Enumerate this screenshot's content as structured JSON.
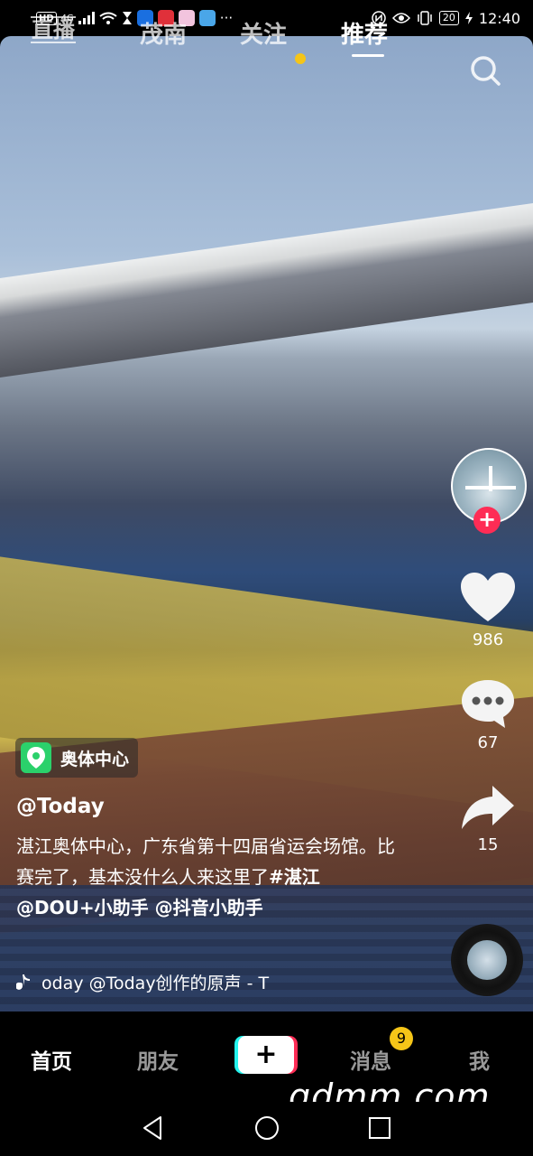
{
  "status_bar": {
    "hd_badge": "HD",
    "network": "4G",
    "ellipsis": "···",
    "battery": "20",
    "time": "12:40"
  },
  "top_tabs": {
    "live": "直播",
    "city": "茂南",
    "follow": "关注",
    "recommend": "推荐"
  },
  "rail": {
    "like_count": "986",
    "comment_count": "67",
    "share_count": "15",
    "follow_plus": "+"
  },
  "caption": {
    "location": "奥体中心",
    "author": "@Today",
    "desc_plain": "湛江奥体中心，广东省第十四届省运会场馆。比赛完了，基本没什么人来这里了",
    "desc_tags": "#湛江 @DOU+小助手 @抖音小助手",
    "music": "oday   @Today创作的原声 - T"
  },
  "bottom_nav": {
    "home": "首页",
    "friends": "朋友",
    "create": "+",
    "messages": "消息",
    "messages_badge": "9",
    "me": "我"
  },
  "watermark": "gdmm.com",
  "colors": {
    "accent_red": "#fe2c55",
    "accent_cyan": "#25f4ee",
    "badge_yellow": "#f5c518",
    "location_green": "#2bd16b"
  }
}
